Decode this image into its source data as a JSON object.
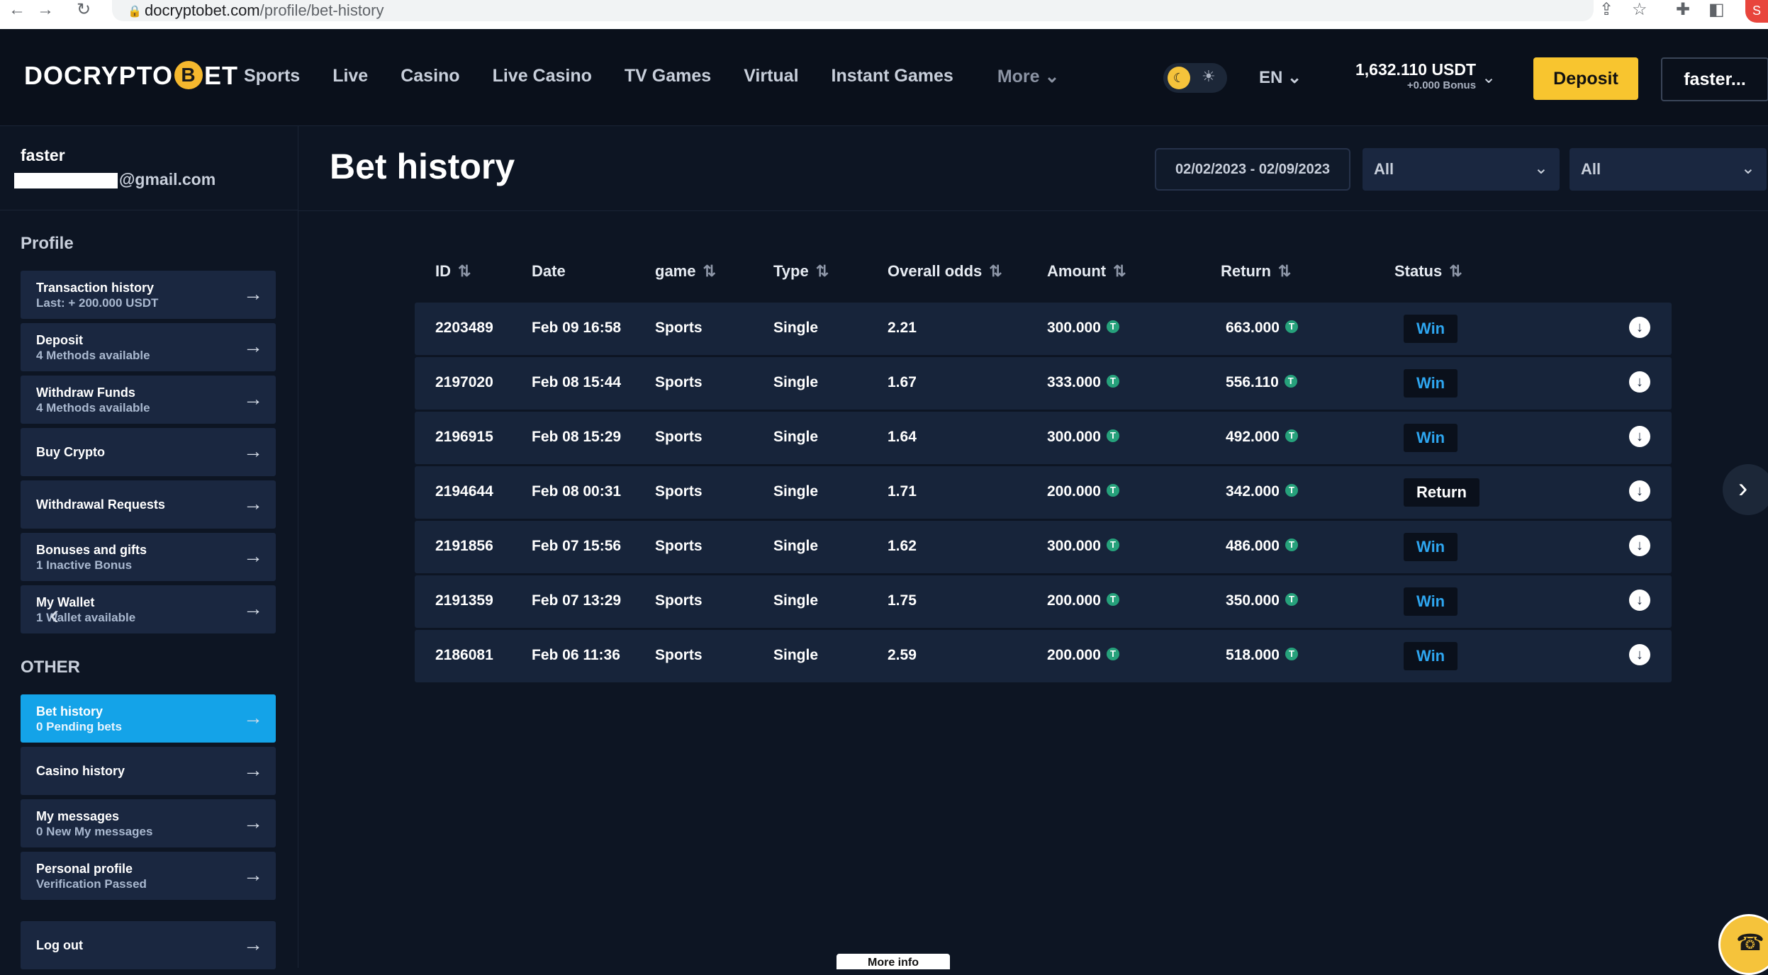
{
  "browser": {
    "url_domain": "docryptobet.com",
    "url_path": "/profile/bet-history",
    "profile_initial": "S"
  },
  "header": {
    "logo_left": "DO",
    "logo_middle": "CRYPTO",
    "logo_coin": "B",
    "logo_right": "ET",
    "nav": [
      "Sports",
      "Live",
      "Casino",
      "Live Casino",
      "TV Games",
      "Virtual",
      "Instant Games"
    ],
    "more_label": "More",
    "lang": "EN",
    "balance": "1,632.110 USDT",
    "bonus": "+0.000 Bonus",
    "deposit_label": "Deposit",
    "user_button": "faster..."
  },
  "sidebar": {
    "user_name": "faster",
    "email_suffix": "@gmail.com",
    "profile_title": "Profile",
    "profile_items": [
      {
        "label": "Transaction history",
        "sub": "Last: + 200.000 USDT"
      },
      {
        "label": "Deposit",
        "sub": "4 Methods available"
      },
      {
        "label": "Withdraw Funds",
        "sub": "4 Methods available"
      },
      {
        "label": "Buy Crypto",
        "sub": ""
      },
      {
        "label": "Withdrawal Requests",
        "sub": ""
      },
      {
        "label": "Bonuses and gifts",
        "sub": "1 Inactive Bonus"
      },
      {
        "label": "My Wallet",
        "sub": "1 Wallet available"
      }
    ],
    "other_title": "OTHER",
    "other_items": [
      {
        "label": "Bet history",
        "sub": "0 Pending bets"
      },
      {
        "label": "Casino history",
        "sub": ""
      },
      {
        "label": "My messages",
        "sub": "0 New My messages"
      },
      {
        "label": "Personal profile",
        "sub": "Verification Passed"
      }
    ],
    "logout_label": "Log out"
  },
  "main": {
    "title": "Bet history",
    "date_range": "02/02/2023 - 02/09/2023",
    "filter1": "All",
    "filter2": "All",
    "columns": [
      "ID",
      "Date",
      "game",
      "Type",
      "Overall odds",
      "Amount",
      "Return",
      "Status"
    ],
    "rows": [
      {
        "id": "2203489",
        "date": "Feb 09 16:58",
        "game": "Sports",
        "type": "Single",
        "odds": "2.21",
        "amount": "300.000",
        "return": "663.000",
        "status": "Win"
      },
      {
        "id": "2197020",
        "date": "Feb 08 15:44",
        "game": "Sports",
        "type": "Single",
        "odds": "1.67",
        "amount": "333.000",
        "return": "556.110",
        "status": "Win"
      },
      {
        "id": "2196915",
        "date": "Feb 08 15:29",
        "game": "Sports",
        "type": "Single",
        "odds": "1.64",
        "amount": "300.000",
        "return": "492.000",
        "status": "Win"
      },
      {
        "id": "2194644",
        "date": "Feb 08 00:31",
        "game": "Sports",
        "type": "Single",
        "odds": "1.71",
        "amount": "200.000",
        "return": "342.000",
        "status": "Return"
      },
      {
        "id": "2191856",
        "date": "Feb 07 15:56",
        "game": "Sports",
        "type": "Single",
        "odds": "1.62",
        "amount": "300.000",
        "return": "486.000",
        "status": "Win"
      },
      {
        "id": "2191359",
        "date": "Feb 07 13:29",
        "game": "Sports",
        "type": "Single",
        "odds": "1.75",
        "amount": "200.000",
        "return": "350.000",
        "status": "Win"
      },
      {
        "id": "2186081",
        "date": "Feb 06 11:36",
        "game": "Sports",
        "type": "Single",
        "odds": "2.59",
        "amount": "200.000",
        "return": "518.000",
        "status": "Win"
      }
    ],
    "token_symbol": "T",
    "more_info_tab": "More info"
  },
  "colors": {
    "accent_yellow": "#f8c52f",
    "active_blue": "#14a3e8",
    "win_blue": "#2ea6f0",
    "usdt_green": "#26a17b",
    "background": "#0d1523"
  },
  "icons": {
    "back": "back-arrow-icon",
    "forward": "forward-arrow-icon",
    "reload": "reload-icon",
    "sort": "sort-arrows-icon",
    "download": "download-circle-icon",
    "menu_arrow": "right-arrow-icon"
  }
}
